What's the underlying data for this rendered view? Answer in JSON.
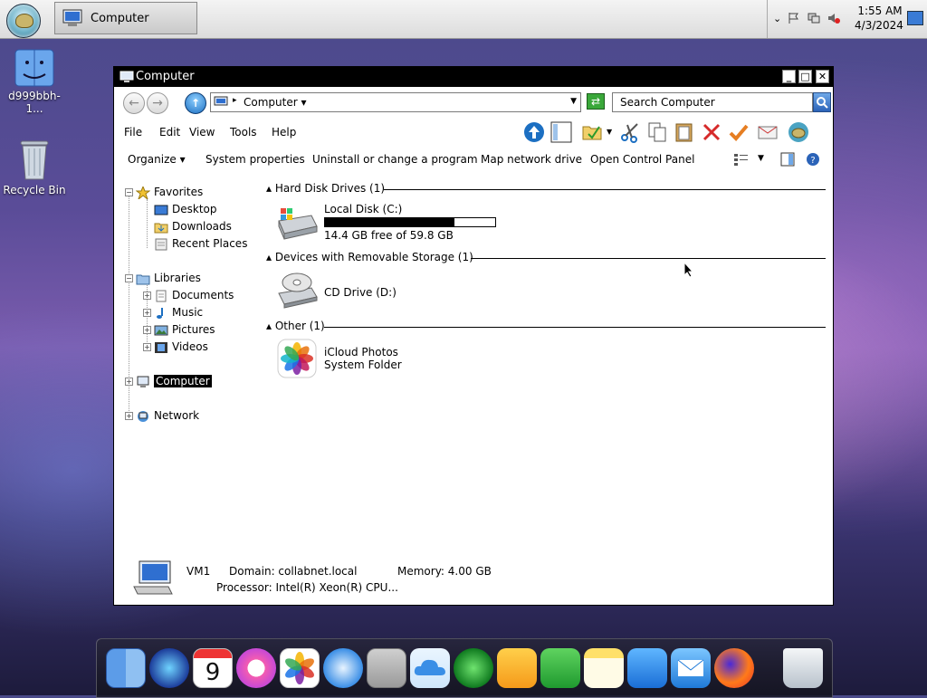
{
  "taskbar": {
    "task_label": "Computer",
    "clock_time": "1:55 AM",
    "clock_date": "4/3/2024"
  },
  "desktop": {
    "icons": [
      {
        "label": "d999bbh-1..."
      },
      {
        "label": "Recycle Bin"
      }
    ]
  },
  "window": {
    "title": "Computer",
    "address": {
      "crumb": "Computer"
    },
    "search_placeholder": "Search Computer",
    "menu": [
      "File",
      "Edit",
      "View",
      "Tools",
      "Help"
    ],
    "commands": [
      "Organize",
      "System properties",
      "Uninstall or change a program",
      "Map network drive",
      "Open Control Panel"
    ],
    "nav": {
      "favorites": "Favorites",
      "desktop": "Desktop",
      "downloads": "Downloads",
      "recent": "Recent Places",
      "libraries": "Libraries",
      "documents": "Documents",
      "music": "Music",
      "pictures": "Pictures",
      "videos": "Videos",
      "computer": "Computer",
      "network": "Network"
    },
    "groups": {
      "hdd": "Hard Disk Drives (1)",
      "removable": "Devices with Removable Storage (1)",
      "other": "Other (1)"
    },
    "items": {
      "local_disk_name": "Local Disk (C:)",
      "local_disk_free": "14.4 GB free of 59.8 GB",
      "local_disk_used_fraction": 0.76,
      "cd_name": "CD Drive (D:)",
      "icloud_name": "iCloud Photos",
      "icloud_type": "System Folder"
    },
    "details": {
      "name": "VM1",
      "domain": "Domain: collabnet.local",
      "memory": "Memory: 4.00 GB",
      "processor": "Processor: Intel(R) Xeon(R) CPU..."
    }
  },
  "dock": {
    "calendar_day": "9",
    "apps": [
      "finder",
      "siri",
      "calendar",
      "itunes",
      "photos",
      "safari",
      "contacts",
      "icloud",
      "find-my",
      "pages",
      "numbers",
      "notes",
      "keynote",
      "mail",
      "firefox",
      "trash"
    ]
  },
  "colors": {
    "accent": "#1c6fc2",
    "titlebar": "#000000"
  }
}
